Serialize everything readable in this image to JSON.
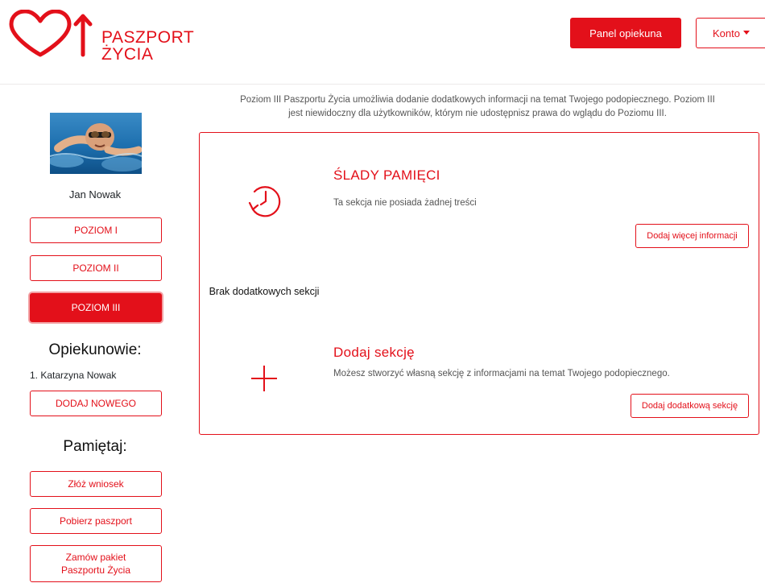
{
  "header": {
    "logo_text_line1": "PASZPORT",
    "logo_text_line2": "ŻYCIA",
    "panel_button": "Panel opiekuna",
    "account_button": "Konto"
  },
  "sidebar": {
    "patient_name": "Jan Nowak",
    "level_buttons": [
      "POZIOM I",
      "POZIOM II",
      "POZIOM III"
    ],
    "active_level": "POZIOM III",
    "caregivers_title": "Opiekunowie:",
    "caregivers": [
      "1. Katarzyna Nowak"
    ],
    "add_new_button": "DODAJ NOWEGO",
    "remember_title": "Pamiętaj:",
    "remember_buttons": [
      "Złóż wniosek",
      "Pobierz paszport"
    ],
    "order_package_line1": "Zamów pakiet",
    "order_package_line2": "Paszportu Życia"
  },
  "main": {
    "intro_line1": "Poziom III Paszportu Życia umożliwia dodanie dodatkowych informacji na temat Twojego podopiecznego. Poziom III",
    "intro_line2": "jest niewidoczny dla użytkowników, którym nie udostępnisz prawa do wglądu do Poziomu III.",
    "no_sections": "Brak dodatkowych sekcji",
    "memory": {
      "title": "ŚLADY PAMIĘCI",
      "description": "Ta sekcja nie posiada żadnej treści",
      "button": "Dodaj więcej informacji",
      "icon": "history-clock-icon"
    },
    "add_section": {
      "title": "Dodaj sekcję",
      "description": "Możesz stworzyć własną sekcję z informacjami na temat Twojego podopiecznego.",
      "button": "Dodaj dodatkową sekcję",
      "icon": "plus-icon"
    }
  },
  "colors": {
    "brand_red": "#e3101a",
    "border_light": "#eceaea"
  }
}
